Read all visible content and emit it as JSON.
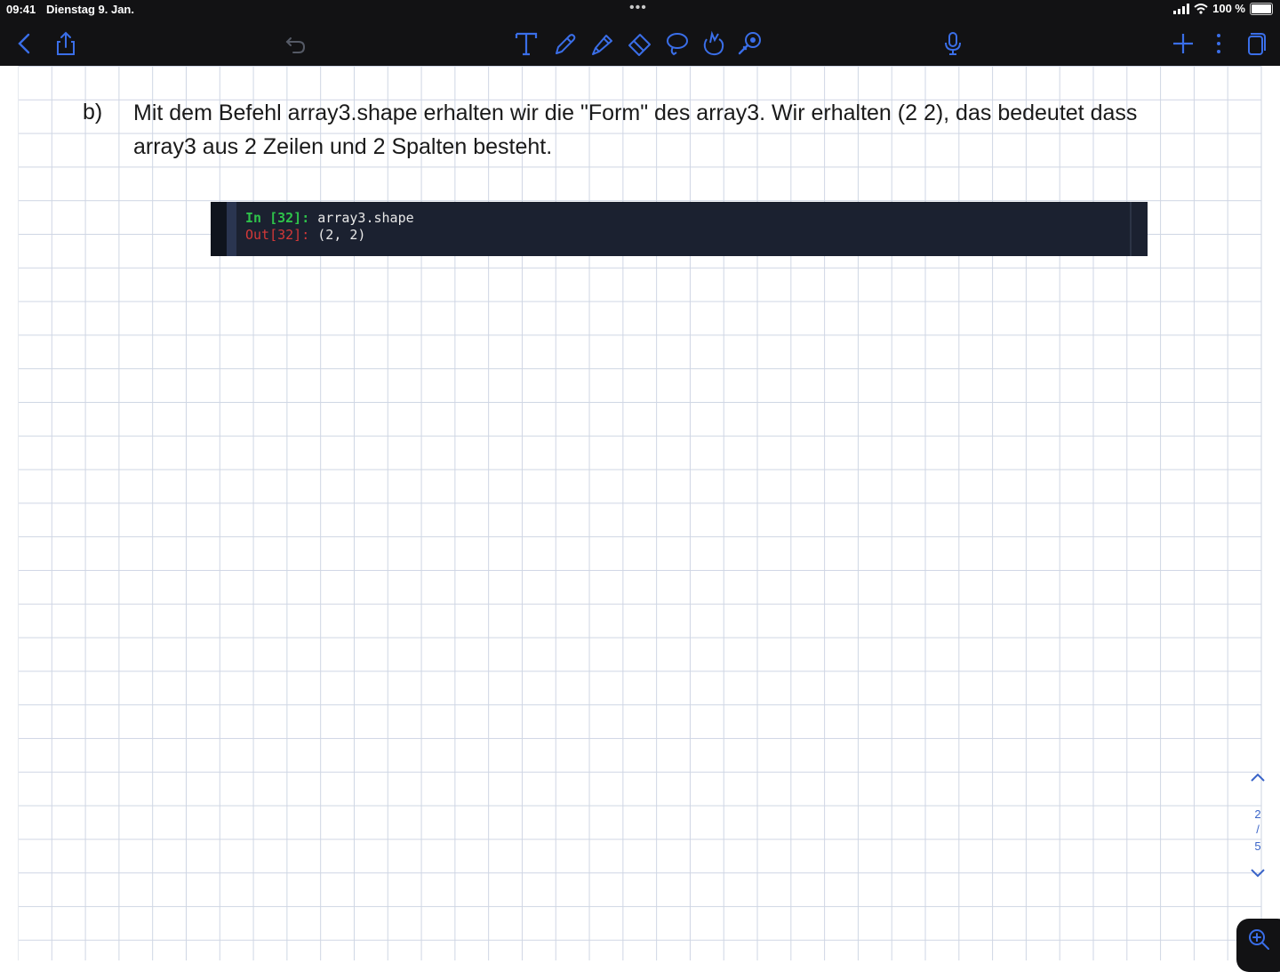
{
  "status_bar": {
    "time": "09:41",
    "date": "Dienstag 9. Jan.",
    "battery_percent": "100 %",
    "battery_level": 1.0
  },
  "toolbar": {
    "left": [
      "back-icon",
      "share-icon",
      "undo-icon"
    ],
    "tools": [
      "text-tool-icon",
      "pen-tool-icon",
      "highlighter-tool-icon",
      "eraser-tool-icon",
      "lasso-tool-icon",
      "shapes-tool-icon",
      "laser-pointer-icon"
    ],
    "right": [
      "microphone-icon",
      "add-page-icon",
      "more-icon",
      "pages-icon"
    ],
    "icon_color": "#3a6ee8"
  },
  "note": {
    "label": "b)",
    "line1": "Mit dem Befehl array3.shape erhalten wir die \"Form\" des array3. Wir erhalten (2 2), das bedeutet dass",
    "line2": "array3 aus 2 Zeilen und 2 Spalten besteht."
  },
  "code_cell": {
    "in_prompt": "In [32]:",
    "in_code": "array3.shape",
    "out_prompt": "Out[32]:",
    "out_value": "(2, 2)",
    "in_color": "#2ec24a",
    "out_color": "#d33838"
  },
  "pager": {
    "current": "2",
    "separator": "/",
    "total": "5"
  }
}
